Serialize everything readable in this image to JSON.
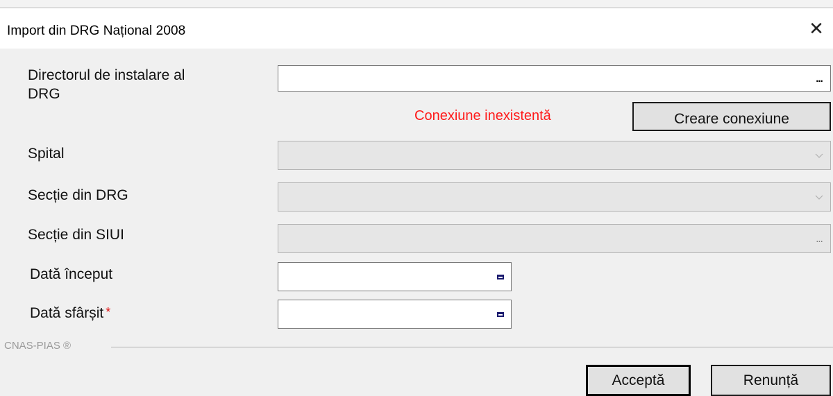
{
  "window": {
    "title": "Import din DRG Național 2008",
    "close_icon": "close-icon"
  },
  "form": {
    "install_dir": {
      "label_line1": "Directorul de instalare al",
      "label_line2": "DRG",
      "value": "",
      "browse_label": "..."
    },
    "connection_status": "Conexiune inexistentă",
    "create_connection_label": "Creare conexiune",
    "hospital": {
      "label": "Spital",
      "value": ""
    },
    "drg_section": {
      "label": "Secție din DRG",
      "value": ""
    },
    "siui_section": {
      "label": "Secție din SIUI",
      "value": "",
      "browse_label": "..."
    },
    "start_date": {
      "label": "Dată început",
      "value": ""
    },
    "end_date": {
      "label": "Dată sfârșit",
      "required_marker": "*",
      "value": ""
    }
  },
  "footer": {
    "brand": "CNAS-PIAS ®",
    "accept_label": "Acceptă",
    "cancel_label": "Renunță"
  },
  "colors": {
    "status_error": "#ff1a1a",
    "required": "#e01010"
  }
}
